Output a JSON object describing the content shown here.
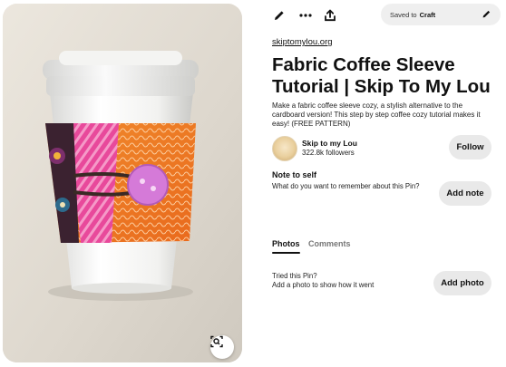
{
  "toolbar": {
    "edit_icon": "pencil-icon",
    "more_icon": "more-horizontal-icon",
    "share_icon": "share-upload-icon"
  },
  "saved": {
    "prefix": "Saved to",
    "board": "Craft",
    "edit_icon": "pencil-icon"
  },
  "pin": {
    "source": "skiptomylou.org",
    "title": "Fabric Coffee Sleeve Tutorial | Skip To My Lou",
    "description": "Make a fabric coffee sleeve cozy, a stylish alternative to the cardboard version! This step by step coffee cozy tutorial makes it easy! (FREE PATTERN)"
  },
  "creator": {
    "name": "Skip to my Lou",
    "followers": "322.8k followers",
    "follow_label": "Follow"
  },
  "note": {
    "heading": "Note to self",
    "prompt": "What do you want to remember about this Pin?",
    "button_label": "Add note"
  },
  "tabs": [
    {
      "label": "Photos",
      "active": true
    },
    {
      "label": "Comments",
      "active": false
    }
  ],
  "tried": {
    "title": "Tried this Pin?",
    "subtitle": "Add a photo to show how it went",
    "button_label": "Add photo"
  },
  "image": {
    "visual_search_icon": "visual-search-lens-icon"
  },
  "colors": {
    "button_gray": "#e9e9e9",
    "pill_gray": "#efefef",
    "text": "#111111",
    "muted_tab": "#767676"
  }
}
